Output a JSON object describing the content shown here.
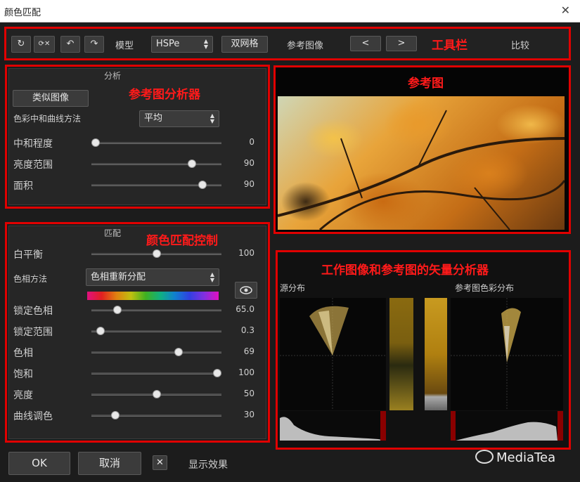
{
  "window": {
    "title": "颜色匹配",
    "close": "✕"
  },
  "annotations": {
    "toolbar": "工具栏",
    "analyzer": "参考图分析器",
    "reference": "参考图",
    "matching": "颜色匹配控制",
    "vectorscope": "工作图像和参考图的矢量分析器"
  },
  "toolbar": {
    "icons": [
      "↻",
      "⟳✕",
      "↶",
      "↷"
    ],
    "model_label": "模型",
    "model_value": "HSPe",
    "dual_grid": "双网格",
    "ref_image_label": "参考图像",
    "prev": "<",
    "next": ">",
    "compare": "比较"
  },
  "analysis": {
    "title": "分析",
    "similar_button": "类似图像",
    "method_label": "色彩中和曲线方法",
    "method_value": "平均",
    "sliders": [
      {
        "label": "中和程度",
        "value": "0",
        "level": 0
      },
      {
        "label": "亮度范围",
        "value": "90",
        "level": 0.79
      },
      {
        "label": "面积",
        "value": "90",
        "level": 0.88
      }
    ]
  },
  "matching": {
    "title": "匹配",
    "white_balance": {
      "label": "白平衡",
      "value": "100",
      "level": 0.5
    },
    "hue_method_label": "色相方法",
    "hue_method_value": "色相重新分配",
    "sliders": [
      {
        "label": "锁定色相",
        "value": "65.0",
        "level": 0.18
      },
      {
        "label": "锁定范围",
        "value": "0.3",
        "level": 0.04
      },
      {
        "label": "色相",
        "value": "69",
        "level": 0.68
      },
      {
        "label": "饱和",
        "value": "100",
        "level": 1.0
      },
      {
        "label": "亮度",
        "value": "50",
        "level": 0.5
      },
      {
        "label": "曲线调色",
        "value": "30",
        "level": 0.16
      }
    ]
  },
  "scopes": {
    "source_label": "源分布",
    "reference_label": "参考图色彩分布"
  },
  "footer": {
    "ok": "OK",
    "cancel": "取消",
    "checkbox_mark": "✕",
    "show_effect": "显示效果"
  },
  "watermark": {
    "text": "MediaTea"
  },
  "colors": {
    "accent_red": "#e00000",
    "bg": "#1c1c1c"
  }
}
